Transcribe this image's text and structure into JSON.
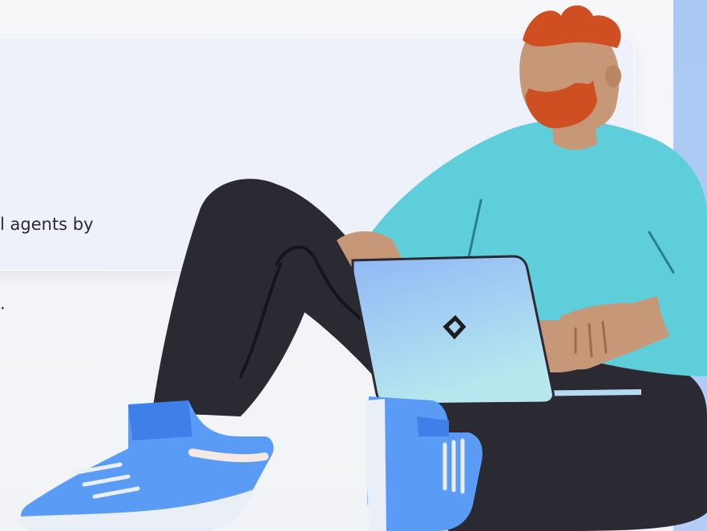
{
  "card": {
    "line1": "l agents by",
    "line2": "."
  }
}
